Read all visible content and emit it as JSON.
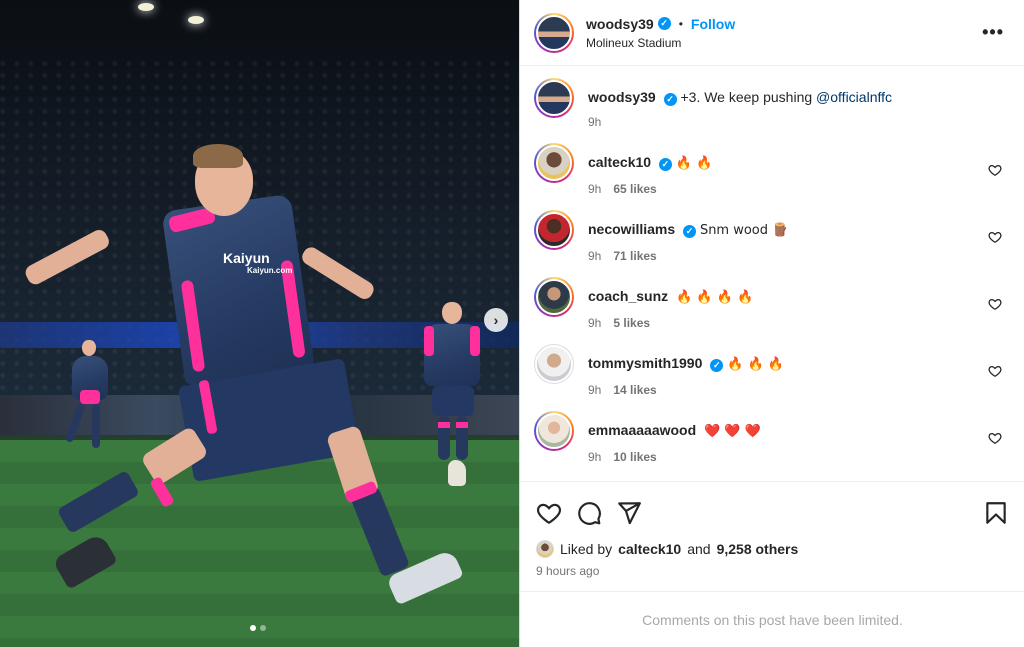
{
  "post": {
    "author": "woodsy39",
    "follow_label": "Follow",
    "separator": "•",
    "location": "Molineux Stadium",
    "more_label": "•••",
    "caption_text": "+3. We keep pushing",
    "caption_mention": "@officialnffc",
    "caption_time": "9h",
    "photo_sponsor": "Kaiyun",
    "photo_sponsor_small": "Kaiyun.com",
    "next_label": "›"
  },
  "comments": [
    {
      "user": "calteck10",
      "text": "🔥 🔥",
      "time": "9h",
      "likes": "65 likes",
      "avatar": "av-calteck",
      "verified": true
    },
    {
      "user": "necowilliams",
      "text": "Snm wood 🪵",
      "time": "9h",
      "likes": "71 likes",
      "avatar": "av-neco",
      "verified": true
    },
    {
      "user": "coach_sunz",
      "text": "🔥 🔥 🔥 🔥",
      "time": "9h",
      "likes": "5 likes",
      "avatar": "av-coach",
      "verified": false
    },
    {
      "user": "tommysmith1990",
      "text": "🔥 🔥 🔥",
      "time": "9h",
      "likes": "14 likes",
      "avatar": "av-tommy",
      "verified": true
    },
    {
      "user": "emmaaaaawood",
      "text": "❤️ ❤️ ❤️",
      "time": "9h",
      "likes": "10 likes",
      "avatar": "av-emma",
      "verified": false
    }
  ],
  "likes_summary": {
    "prefix": "Liked by",
    "user": "calteck10",
    "and": "and",
    "others": "9,258 others"
  },
  "post_time": "9 hours ago",
  "limited_notice": "Comments on this post have been limited.",
  "carousel": {
    "total_slides": 2,
    "active_slide": 1
  },
  "colors": {
    "accent": "#0095f6",
    "mention": "#00376b",
    "muted": "#737373",
    "kit_pink": "#ff2f9b"
  }
}
